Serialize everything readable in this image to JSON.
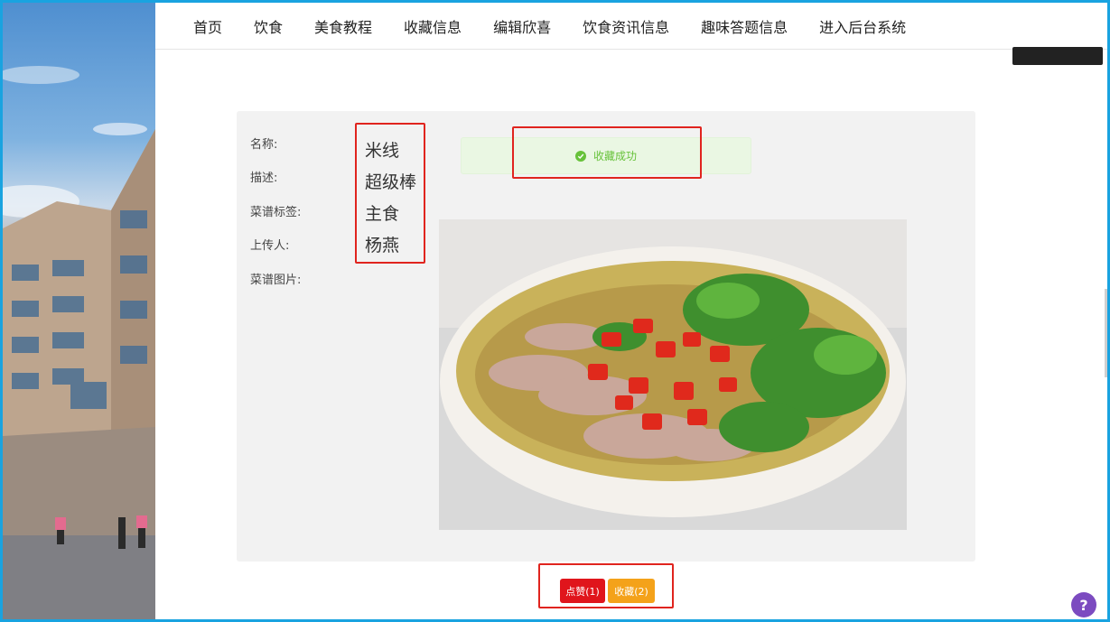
{
  "nav": {
    "items": [
      "首页",
      "饮食",
      "美食教程",
      "收藏信息",
      "编辑欣喜",
      "饮食资讯信息",
      "趣味答题信息",
      "进入后台系统"
    ]
  },
  "detail": {
    "labels": {
      "name": "名称:",
      "description": "描述:",
      "tags": "菜谱标签:",
      "uploader": "上传人:",
      "image": "菜谱图片:"
    },
    "values": {
      "name": "米线",
      "description": "超级棒",
      "tags": "主食",
      "uploader": "杨燕"
    }
  },
  "toast": {
    "message": "收藏成功",
    "icon": "check-circle-icon",
    "color": "#67c23a"
  },
  "actions": {
    "like_label": "点赞(1)",
    "favorite_label": "收藏(2)",
    "like_color": "#e0151c",
    "favorite_color": "#f4a21a"
  },
  "help": {
    "icon": "help-icon",
    "label": "?"
  },
  "colors": {
    "highlight_box": "#e0241e",
    "frame": "#19a3e0"
  }
}
